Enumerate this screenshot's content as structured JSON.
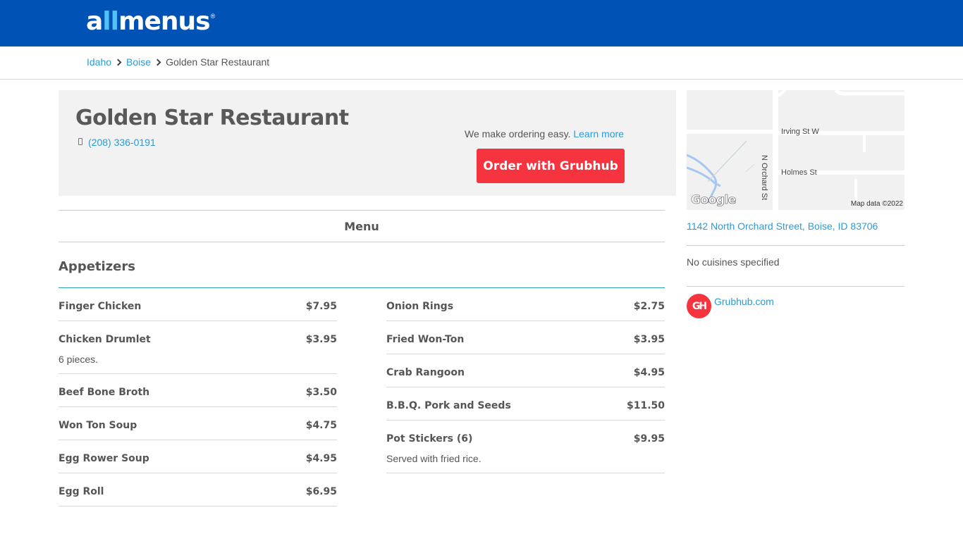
{
  "header": {
    "logo_part1": "a",
    "logo_highlight": "ll",
    "logo_part2": "menus",
    "logo_reg": "®"
  },
  "breadcrumb": {
    "items": [
      "Idaho",
      "Boise"
    ],
    "current": "Golden Star Restaurant"
  },
  "restaurant": {
    "name": "Golden Star Restaurant",
    "phone": "(208) 336-0191",
    "order_easy_text": "We make ordering easy.",
    "learn_more": "Learn more",
    "order_button": "Order with Grubhub"
  },
  "menu_tab": "Menu",
  "section": {
    "title": "Appetizers",
    "left_items": [
      {
        "name": "Finger Chicken",
        "price": "$7.95",
        "desc": ""
      },
      {
        "name": "Chicken Drumlet",
        "price": "$3.95",
        "desc": "6 pieces."
      },
      {
        "name": "Beef Bone Broth",
        "price": "$3.50",
        "desc": ""
      },
      {
        "name": "Won Ton Soup",
        "price": "$4.75",
        "desc": ""
      },
      {
        "name": "Egg Rower Soup",
        "price": "$4.95",
        "desc": ""
      },
      {
        "name": "Egg Roll",
        "price": "$6.95",
        "desc": ""
      }
    ],
    "right_items": [
      {
        "name": "Onion Rings",
        "price": "$2.75",
        "desc": ""
      },
      {
        "name": "Fried Won-Ton",
        "price": "$3.95",
        "desc": ""
      },
      {
        "name": "Crab Rangoon",
        "price": "$4.95",
        "desc": ""
      },
      {
        "name": "B.B.Q. Pork and Seeds",
        "price": "$11.50",
        "desc": ""
      },
      {
        "name": "Pot Stickers (6)",
        "price": "$9.95",
        "desc": "Served with fried rice."
      }
    ]
  },
  "map": {
    "street1": "Irving St W",
    "street2": "Holmes St",
    "street3": "N Orchard St",
    "google": "Google",
    "map_data": "Map data ©2022"
  },
  "sidebar": {
    "address": "1142 North Orchard Street, Boise, ID 83706",
    "cuisines": "No cuisines specified",
    "grubhub_icon": "GH",
    "grubhub_link": "Grubhub.com"
  },
  "colors": {
    "header_bg": "#0052b4",
    "link": "#2a9bd7",
    "grubhub_red": "#f63440",
    "section_rule": "#2aa3a8"
  }
}
